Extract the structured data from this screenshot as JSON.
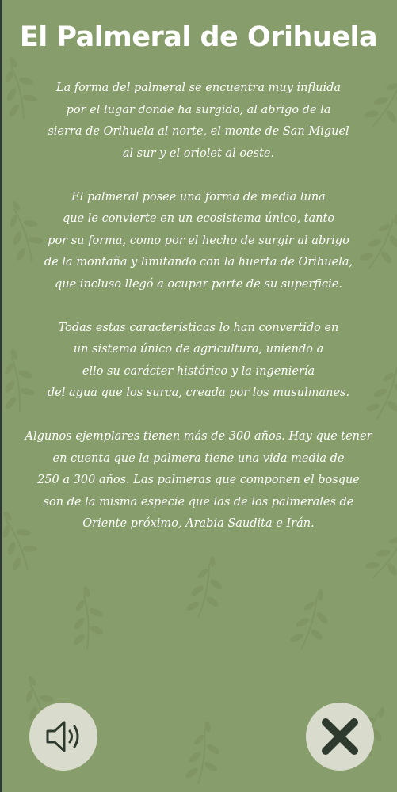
{
  "header": {
    "title": "El Palmeral de Orihuela"
  },
  "content": {
    "paragraphs": [
      {
        "lines": [
          "La forma del palmeral se encuentra muy influida",
          "por el lugar donde ha surgido, al abrigo de la",
          "sierra de Orihuela al norte, el monte de San Miguel",
          "al sur y el oriolet al oeste."
        ]
      },
      {
        "lines": [
          "El palmeral posee una forma de media luna",
          "que le convierte en un ecosistema único, tanto",
          "por su forma, como por el hecho de surgir al abrigo",
          "de la montaña y limitando con la huerta de Orihuela,",
          "que incluso llegó a ocupar parte de su superficie."
        ]
      },
      {
        "lines": [
          "Todas estas características lo han convertido en",
          "un sistema único de agricultura, uniendo a",
          "ello su carácter histórico y la ingeniería",
          "del agua que los surca, creada por los musulmanes."
        ]
      },
      {
        "lines": [
          "Algunos ejemplares tienen más de 300 años. Hay que tener",
          "en cuenta que la palmera tiene una vida media de",
          "250 a 300 años. Las palmeras que componen el bosque",
          "son de la misma especie que las de los palmerales de",
          "Oriente próximo, Arabia Saudita e Irán."
        ]
      }
    ]
  },
  "controls": {
    "sound_icon": "speaker-icon",
    "close_icon": "close-icon"
  },
  "colors": {
    "background": "#879d6b",
    "text": "#ffffff",
    "button_bg": "#d9dccd",
    "icon": "#2f3a2f"
  }
}
